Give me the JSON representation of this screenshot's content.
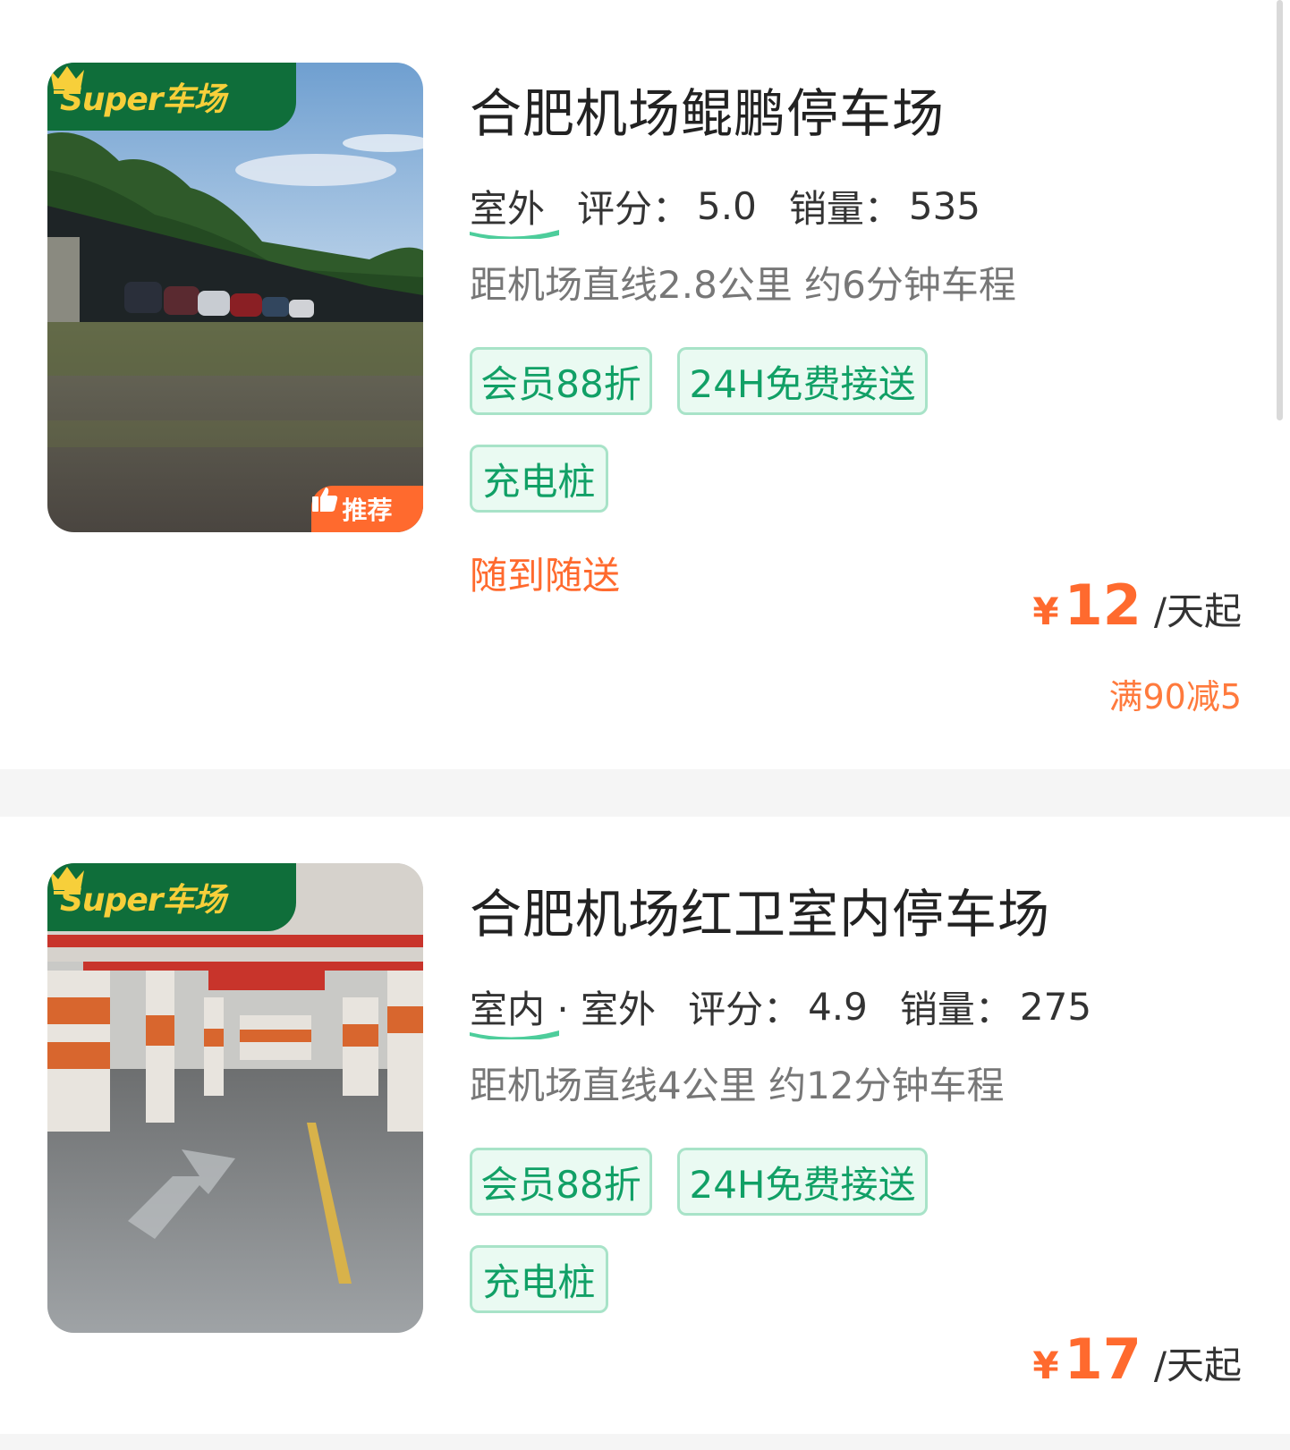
{
  "colors": {
    "accent_green": "#11a066",
    "accent_orange": "#ff6a2e",
    "badge_green": "#0f6e3a",
    "badge_gold": "#f7cf3a"
  },
  "badges": {
    "super": "Super车场",
    "recommend": "推荐"
  },
  "currency": "¥",
  "unit": "/天起",
  "labels": {
    "rating": "评分：",
    "sales": "销量："
  },
  "lots": [
    {
      "name": "合肥机场鲲鹏停车场",
      "type": "室外",
      "rating": "5.0",
      "sales": "535",
      "distance": "距机场直线2.8公里 约6分钟车程",
      "tags": [
        "会员88折",
        "24H免费接送",
        "充电桩"
      ],
      "service": "随到随送",
      "price": "12",
      "promo": "满90减5",
      "recommended": true,
      "image": "outdoor-gravel-lot-photo"
    },
    {
      "name": "合肥机场红卫室内停车场",
      "type": "室内 · 室外",
      "rating": "4.9",
      "sales": "275",
      "distance": "距机场直线4公里 约12分钟车程",
      "tags": [
        "会员88折",
        "24H免费接送",
        "充电桩"
      ],
      "price": "17",
      "recommended": false,
      "image": "indoor-garage-photo"
    }
  ]
}
